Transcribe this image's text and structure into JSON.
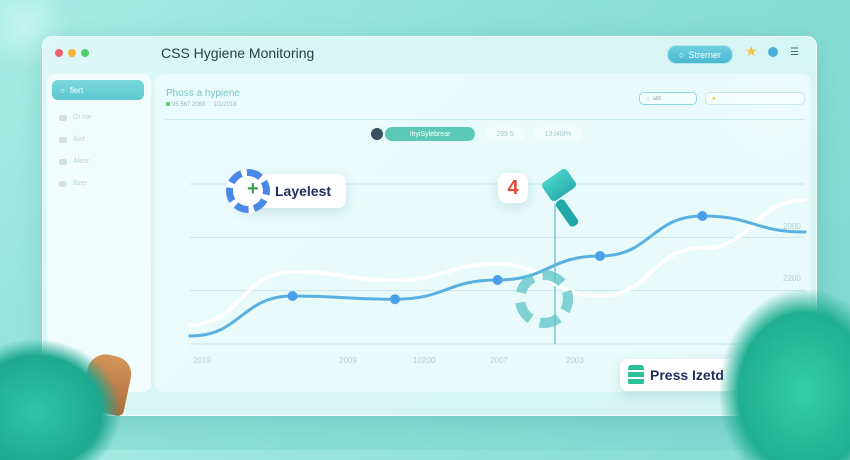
{
  "window": {
    "title": "CSS Hygiene Monitoring",
    "controls": [
      "close",
      "minimize",
      "maximize"
    ],
    "streamer_label": "Strerner"
  },
  "sidebar": {
    "search_label": "fiert",
    "items": [
      {
        "label": "Oi me",
        "icon": "user-icon"
      },
      {
        "label": "Aist",
        "icon": "folder-icon"
      },
      {
        "label": "Alear",
        "icon": "chat-icon"
      },
      {
        "label": "Bzer",
        "icon": "tag-icon"
      }
    ]
  },
  "main": {
    "title": "Phoss a hypiene",
    "meta": [
      "95 567 2083",
      "1/1/2018"
    ],
    "filter_label": "abt",
    "user_chip": "!hyiSylebrear",
    "chip_2": "299 5",
    "chip_3": "13:l40l%"
  },
  "chart_data": {
    "type": "line",
    "x": [
      "2019",
      "2009",
      "10200",
      "2007",
      "2003"
    ],
    "yticks": [
      "2000",
      "2200"
    ],
    "series": [
      {
        "values": [
          12,
          45,
          40,
          50,
          30,
          60,
          90
        ]
      },
      {
        "values": [
          5,
          30,
          28,
          40,
          55,
          80,
          70
        ]
      }
    ],
    "grid": true
  },
  "cards": {
    "layers_label": "Layelest",
    "step_number": "4",
    "press_label": "Press Izetd"
  },
  "colors": {
    "accent": "#4ab8d0",
    "teal": "#2fbfb0",
    "navy": "#1f2d5e"
  }
}
